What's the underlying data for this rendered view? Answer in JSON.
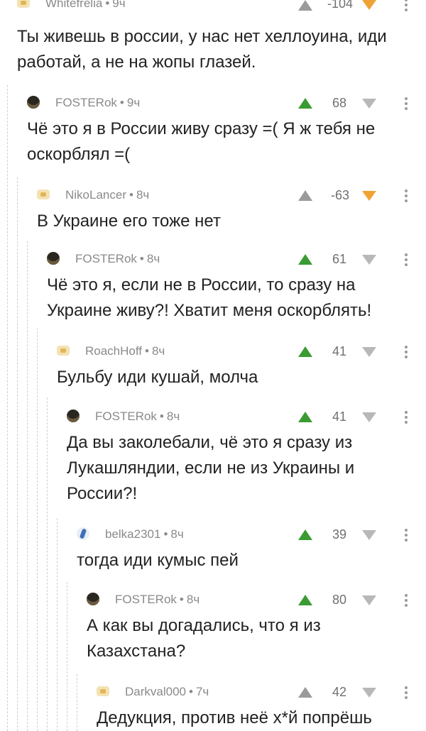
{
  "thread": {
    "comments": [
      {
        "author": "Whitefrelia",
        "time": "9ч",
        "rating": "-104",
        "text": "Ты живешь в россии, у нас нет хеллоуина, иди работай, а не на жопы глазей.",
        "vote": "down"
      },
      {
        "author": "FOSTERok",
        "time": "9ч",
        "rating": "68",
        "text": "Чё это я в России живу сразу =( Я ж тебя не оскорблял =(",
        "vote": "up"
      },
      {
        "author": "NikoLancer",
        "time": "8ч",
        "rating": "-63",
        "text": "В Украине его тоже нет",
        "vote": "down"
      },
      {
        "author": "FOSTERok",
        "time": "8ч",
        "rating": "61",
        "text": "Чё это я, если не в России, то сразу на Украине живу?! Хватит меня оскорблять!",
        "vote": "up"
      },
      {
        "author": "RoachHoff",
        "time": "8ч",
        "rating": "41",
        "text": "Бульбу иди кушай, молча",
        "vote": "up"
      },
      {
        "author": "FOSTERok",
        "time": "8ч",
        "rating": "41",
        "text": "Да вы заколебали, чё это я сразу из Лукашляндии, если не из Украины и России?!",
        "vote": "up"
      },
      {
        "author": "belka2301",
        "time": "8ч",
        "rating": "39",
        "text": "тогда иди кумыс пей",
        "vote": "up"
      },
      {
        "author": "FOSTERok",
        "time": "8ч",
        "rating": "80",
        "text": "А как вы догадались, что я из Казахстана?",
        "vote": "up"
      },
      {
        "author": "Darkval000",
        "time": "7ч",
        "rating": "42",
        "text": "Дедукция, против неё х*й попрёшь",
        "vote": "none"
      }
    ]
  },
  "colors": {
    "upvote": "#3b9b33",
    "downvote_active": "#f0a335",
    "neutral": "#9a9a9a",
    "guide": "#cfcfcf"
  },
  "icons": {
    "upvote": "up-arrow-icon",
    "downvote": "down-arrow-icon",
    "more": "more-vertical-icon"
  }
}
